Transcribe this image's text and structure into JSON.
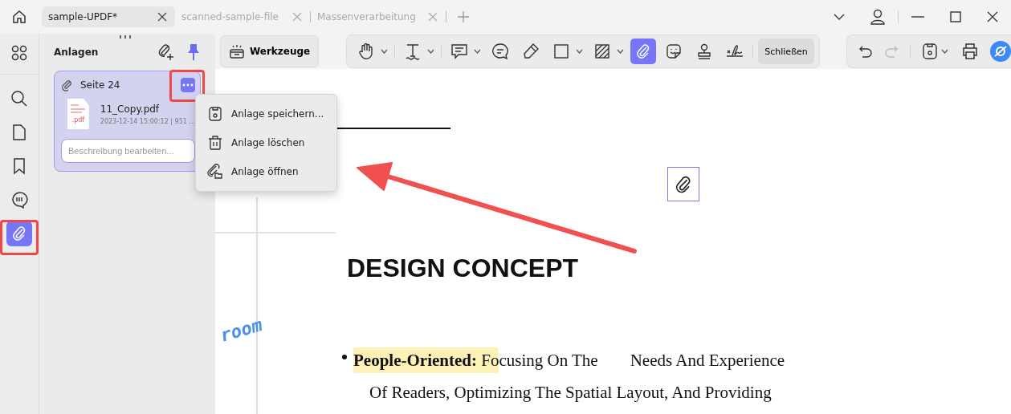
{
  "tabs": [
    {
      "label": "sample-UPDF*",
      "selected": true
    },
    {
      "label": "scanned-sample-file",
      "selected": false
    },
    {
      "label": "Massenverarbeitung",
      "selected": false
    }
  ],
  "rail": [
    {
      "kind": "apps",
      "selected": false
    },
    {
      "kind": "search",
      "selected": false
    },
    {
      "kind": "pages",
      "selected": false
    },
    {
      "kind": "bookmark",
      "selected": false
    },
    {
      "kind": "comments",
      "selected": false
    },
    {
      "kind": "attachment",
      "selected": true
    }
  ],
  "panel": {
    "title": "Anlagen",
    "attachment": {
      "page": "Seite 24",
      "file": "11_Copy.pdf",
      "file_type": ".pdf",
      "meta": "2023-12-14 15:00:12 | 951 ...",
      "placeholder": "Beschreibung bearbeiten..."
    }
  },
  "menu": [
    {
      "kind": "save",
      "label": "Anlage speichern..."
    },
    {
      "kind": "delete",
      "label": "Anlage löschen"
    },
    {
      "kind": "open",
      "label": "Anlage öffnen"
    }
  ],
  "toolbar": {
    "tools_label": "Werkzeuge",
    "close_label": "Schließen",
    "tools": [
      {
        "kind": "hand",
        "dropdown": true,
        "selected": false
      },
      {
        "kind": "text",
        "dropdown": true,
        "selected": false
      },
      {
        "kind": "comment",
        "dropdown": true,
        "selected": false
      },
      {
        "kind": "textbox",
        "dropdown": false,
        "selected": false
      },
      {
        "kind": "pencil",
        "dropdown": false,
        "selected": false
      },
      {
        "kind": "rectangle",
        "dropdown": true,
        "selected": false
      },
      {
        "kind": "area",
        "dropdown": true,
        "selected": false
      },
      {
        "kind": "attachment",
        "dropdown": false,
        "selected": true
      },
      {
        "kind": "sticker",
        "dropdown": false,
        "selected": false
      },
      {
        "kind": "stamp",
        "dropdown": false,
        "selected": false
      },
      {
        "kind": "signature",
        "dropdown": false,
        "selected": false
      }
    ]
  },
  "document": {
    "heading": "DESIGN CONCEPT",
    "handwriting": "room",
    "bullet": [
      "**People-Oriented:** Fo",
      "cusing On The",
      "Needs And Experience",
      "Of Readers, Optimizing The Spatial Layout, And Providing"
    ]
  }
}
